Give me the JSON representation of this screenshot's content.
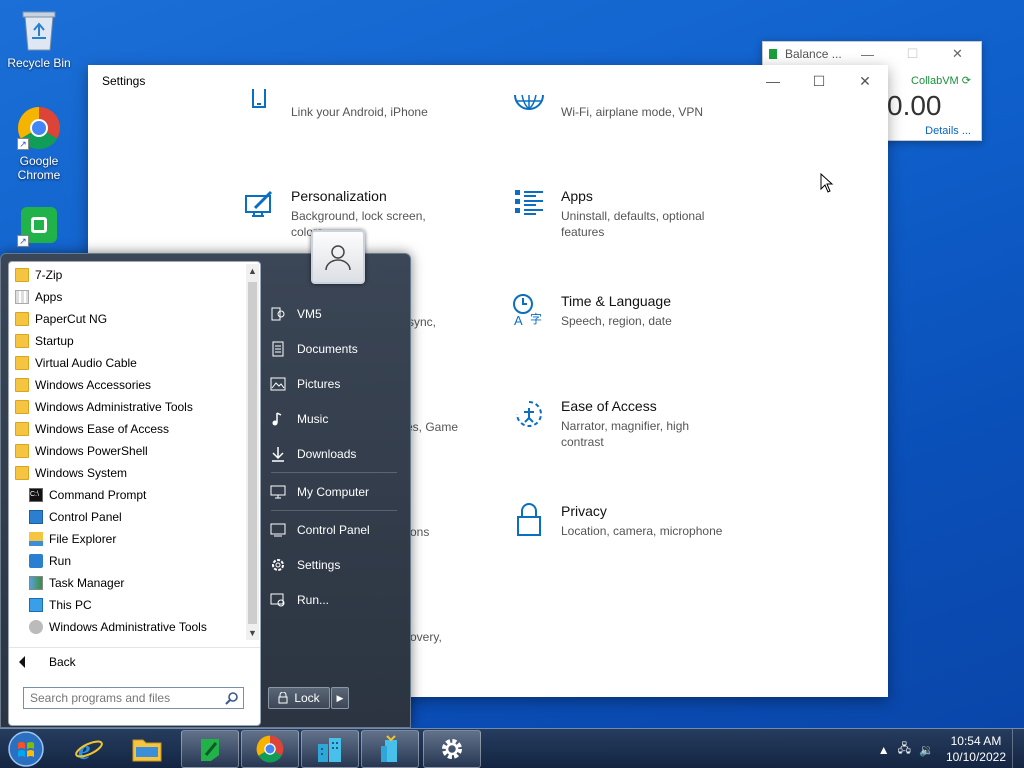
{
  "desktop": {
    "icons": [
      {
        "label": "Recycle Bin"
      },
      {
        "label": "Google Chrome"
      }
    ]
  },
  "balance_window": {
    "title": "Balance ...",
    "collab": "CollabVM",
    "amount": "0.00",
    "details": "Details ..."
  },
  "settings": {
    "title": "Settings",
    "tiles": [
      {
        "name": "",
        "desc": "Link your Android, iPhone",
        "icon": "phone-icon"
      },
      {
        "name": "",
        "desc": "Wi-Fi, airplane mode, VPN",
        "icon": "globe-icon"
      },
      {
        "name": "Personalization",
        "desc": "Background, lock screen, colors",
        "icon": "paintbrush-icon"
      },
      {
        "name": "Apps",
        "desc": "Uninstall, defaults, optional features",
        "icon": "apps-list-icon"
      },
      {
        "name": "Time & Language",
        "desc": "Speech, region, date",
        "icon": "time-language-icon"
      },
      {
        "name": "Ease of Access",
        "desc": "Narrator, magnifier, high contrast",
        "icon": "ease-of-access-icon"
      },
      {
        "name": "Privacy",
        "desc": "Location, camera, microphone",
        "icon": "lock-icon"
      }
    ],
    "fragments": {
      "sync": "sync,",
      "game": "res, Game",
      "ons": "ons",
      "overy": "overy,"
    }
  },
  "start_menu": {
    "programs": [
      {
        "label": "7-Zip",
        "type": "folder"
      },
      {
        "label": "Apps",
        "type": "apps"
      },
      {
        "label": "PaperCut NG",
        "type": "folder"
      },
      {
        "label": "Startup",
        "type": "folder"
      },
      {
        "label": "Virtual Audio Cable",
        "type": "folder"
      },
      {
        "label": "Windows Accessories",
        "type": "folder"
      },
      {
        "label": "Windows Administrative Tools",
        "type": "folder"
      },
      {
        "label": "Windows Ease of Access",
        "type": "folder"
      },
      {
        "label": "Windows PowerShell",
        "type": "folder"
      },
      {
        "label": "Windows System",
        "type": "folder"
      },
      {
        "label": "Command Prompt",
        "type": "cmd"
      },
      {
        "label": "Control Panel",
        "type": "control"
      },
      {
        "label": "File Explorer",
        "type": "explorer"
      },
      {
        "label": "Run",
        "type": "run"
      },
      {
        "label": "Task Manager",
        "type": "taskmgr"
      },
      {
        "label": "This PC",
        "type": "pc"
      },
      {
        "label": "Windows Administrative Tools",
        "type": "admin"
      }
    ],
    "back_label": "Back",
    "search_placeholder": "Search programs and files",
    "right_items": [
      {
        "label": "VM5",
        "icon": "user-folder-icon"
      },
      {
        "label": "Documents",
        "icon": "documents-icon"
      },
      {
        "label": "Pictures",
        "icon": "pictures-icon"
      },
      {
        "label": "Music",
        "icon": "music-icon"
      },
      {
        "label": "Downloads",
        "icon": "downloads-icon"
      },
      {
        "label": "My Computer",
        "icon": "computer-icon"
      },
      {
        "label": "Control Panel",
        "icon": "control-panel-icon"
      },
      {
        "label": "Settings",
        "icon": "gear-icon"
      },
      {
        "label": "Run...",
        "icon": "run-icon"
      }
    ],
    "lock_label": "Lock"
  },
  "taskbar": {
    "time": "10:54 AM",
    "date": "10/10/2022"
  }
}
